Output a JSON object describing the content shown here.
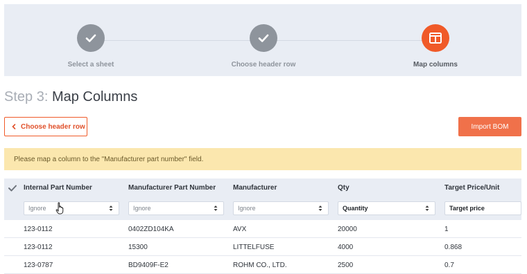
{
  "stepper": {
    "steps": [
      {
        "label": "Select a sheet",
        "status": "done",
        "icon": "check-icon"
      },
      {
        "label": "Choose header row",
        "status": "done",
        "icon": "check-icon"
      },
      {
        "label": "Map columns",
        "status": "active",
        "icon": "columns-icon"
      }
    ]
  },
  "title": {
    "prefix": "Step 3:",
    "main": "Map Columns"
  },
  "buttons": {
    "back": "Choose header row",
    "import": "Import BOM"
  },
  "warning": "Please map a column to the \"Manufacturer part number\" field.",
  "colors": {
    "accent": "#f05a28",
    "warning_bg": "#fbe7ae",
    "header_bg": "#e9edf4"
  },
  "table": {
    "headers": [
      "Internal Part Number",
      "Manufacturer Part Number",
      "Manufacturer",
      "Qty",
      "Target Price/Unit"
    ],
    "mappings": [
      "Ignore",
      "Ignore",
      "Ignore",
      "Quantity",
      "Target price"
    ],
    "rows": [
      [
        "123-0112",
        "0402ZD104KA",
        "AVX",
        "20000",
        "1"
      ],
      [
        "123-0112",
        "15300",
        "LITTELFUSE",
        "4000",
        "0.868"
      ],
      [
        "123-0787",
        "BD9409F-E2",
        "ROHM CO., LTD.",
        "2500",
        "0.7"
      ]
    ]
  }
}
